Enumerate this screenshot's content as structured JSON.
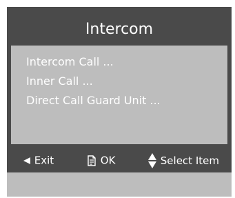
{
  "header": {
    "title": "Intercom"
  },
  "menu": {
    "items": [
      {
        "label": "Intercom Call  ..."
      },
      {
        "label": "Inner Call  ..."
      },
      {
        "label": "Direct Call Guard Unit  ..."
      }
    ]
  },
  "footer": {
    "exit_label": "Exit",
    "ok_label": "OK",
    "select_label": "Select Item",
    "exit_icon": "left-triangle-icon",
    "ok_icon": "document-icon",
    "select_icon": "up-down-triangle-icon"
  },
  "colors": {
    "frame": "#4a4a4a",
    "panel": "#bdbdbd",
    "text": "#ffffff"
  }
}
